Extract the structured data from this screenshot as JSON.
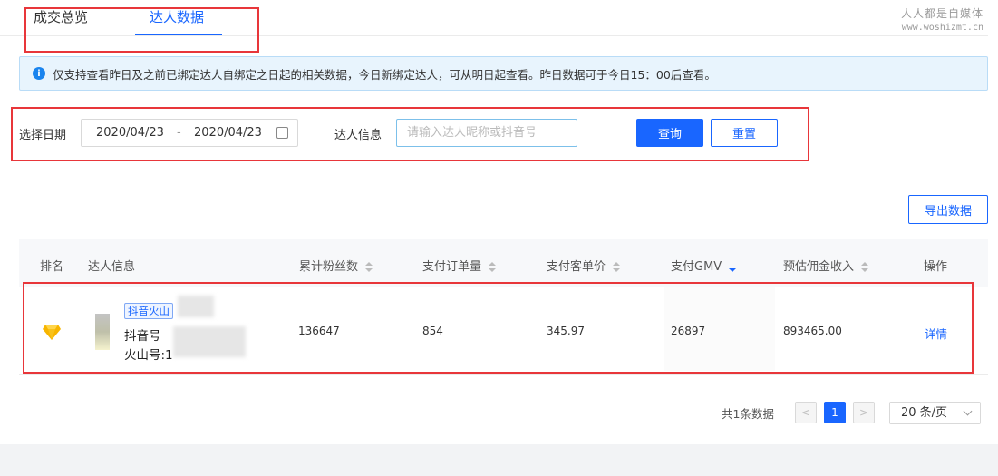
{
  "tabs": [
    {
      "label": "成交总览",
      "active": false
    },
    {
      "label": "达人数据",
      "active": true
    }
  ],
  "watermark": {
    "line1": "人人都是自媒体",
    "line2": "www.woshizmt.cn"
  },
  "notice": {
    "icon": "info-icon",
    "text": "仅支持查看昨日及之前已绑定达人自绑定之日起的相关数据，今日新绑定达人，可从明日起查看。昨日数据可于今日15：00后查看。"
  },
  "filter": {
    "date_label": "选择日期",
    "date_start": "2020/04/23",
    "date_separator": "-",
    "date_end": "2020/04/23",
    "daren_label": "达人信息",
    "search_placeholder": "请输入达人昵称或抖音号",
    "search_value": "",
    "query_label": "查询",
    "reset_label": "重置"
  },
  "export_label": "导出数据",
  "table": {
    "headers": [
      "排名",
      "达人信息",
      "累计粉丝数",
      "支付订单量",
      "支付客单价",
      "支付GMV",
      "预估佣金收入",
      "操作"
    ],
    "sorted_column": "支付GMV",
    "rows": [
      {
        "rank_icon": "diamond-icon",
        "tag": "抖音火山",
        "douyin_prefix": "抖音号",
        "huoshan_prefix": "火山号:1",
        "fans": "136647",
        "orders": "854",
        "unit_price": "345.97",
        "gmv": "26897",
        "commission": "893465.00",
        "action": "详情"
      }
    ]
  },
  "pagination": {
    "total_text": "共1条数据",
    "prev": "<",
    "current": "1",
    "next": ">",
    "page_size": "20 条/页"
  },
  "colors": {
    "accent": "#1966ff",
    "annotation_red": "#e8363a",
    "notice_bg": "#e8f4fd"
  }
}
